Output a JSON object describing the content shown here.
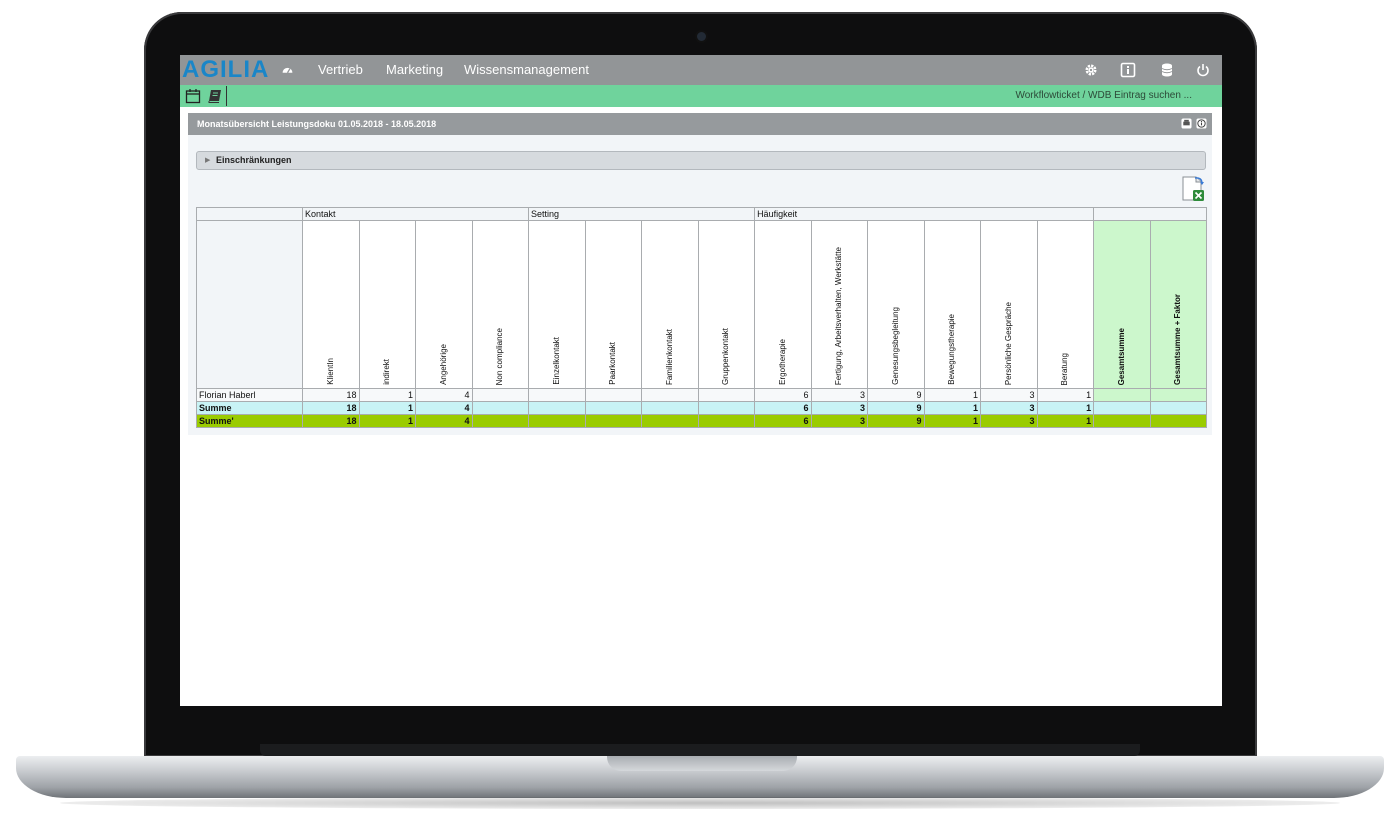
{
  "app": {
    "logo": "AGILIA",
    "nav": [
      "Vertrieb",
      "Marketing",
      "Wissensmanagement"
    ],
    "nav_icons": [
      "dashboard-icon",
      "gear-icon",
      "info-icon",
      "database-icon",
      "power-icon"
    ]
  },
  "toolbar": {
    "icons": [
      "calendar-icon",
      "book-icon"
    ],
    "search_text": "Workflowticket / WDB Eintrag suchen ..."
  },
  "panel": {
    "title": "Monatsübersicht Leistungsdoku 01.05.2018 - 18.05.2018",
    "filter_label": "Einschränkungen"
  },
  "table": {
    "groups": [
      "Kontakt",
      "Setting",
      "Häufigkeit"
    ],
    "columns": [
      "KlientIn",
      "indirekt",
      "Angehörige",
      "Non compliance",
      "Einzelkontakt",
      "Paarkontakt",
      "Familienkontakt",
      "Gruppenkontakt",
      "Ergotherapie",
      "Fertigung, Arbeitsverhalten, Werkstätte",
      "Genesungsbegleitung",
      "Bewegungstherapie",
      "Persönliche Gespräche",
      "Beratung",
      "Gesamtsumme",
      "Gesamtsumme + Faktor"
    ],
    "rows": [
      {
        "label": "Florian Haberl",
        "values": [
          "18",
          "1",
          "4",
          "",
          "",
          "",
          "",
          "",
          "6",
          "3",
          "9",
          "1",
          "3",
          "1",
          "",
          ""
        ]
      },
      {
        "label": "Summe",
        "values": [
          "18",
          "1",
          "4",
          "",
          "",
          "",
          "",
          "",
          "6",
          "3",
          "9",
          "1",
          "3",
          "1",
          "",
          ""
        ]
      },
      {
        "label": "Summe'",
        "values": [
          "18",
          "1",
          "4",
          "",
          "",
          "",
          "",
          "",
          "6",
          "3",
          "9",
          "1",
          "3",
          "1",
          "",
          ""
        ]
      }
    ]
  },
  "colors": {
    "nav_bg": "#929597",
    "toolbar_bg": "#6fd39c",
    "logo": "#1a86c8",
    "summe_row": "#c8f3f5",
    "summe2_row": "#9acc00",
    "total_columns": "#ccf7cc"
  }
}
